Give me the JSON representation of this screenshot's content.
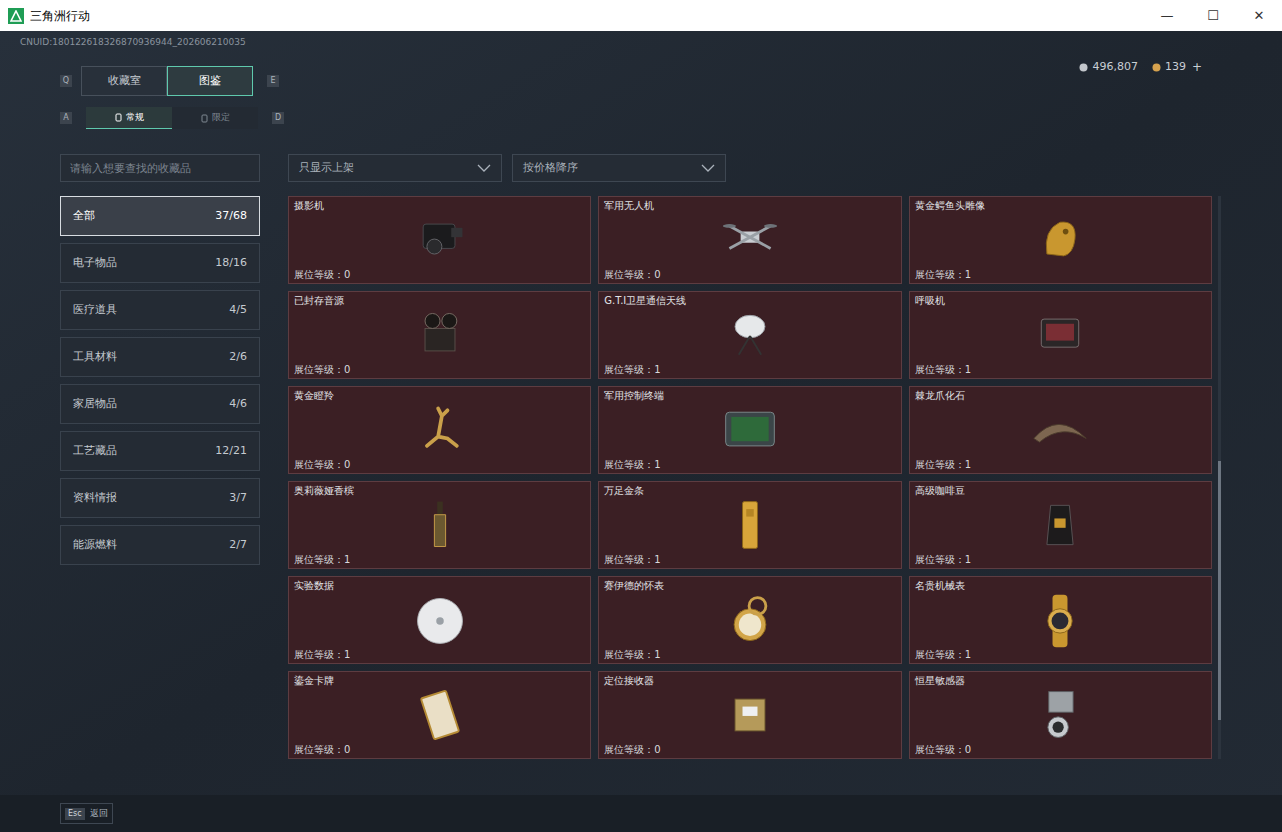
{
  "window": {
    "title": "三角洲行动",
    "controls": [
      "—",
      "☐",
      "✕"
    ]
  },
  "uid": "CNUID:180122618326870936944_202606210035",
  "currency": [
    {
      "amount": "496,807",
      "kind": "silver"
    },
    {
      "amount": "139",
      "kind": "gold"
    }
  ],
  "currency_add": "+",
  "tabs": {
    "left_key": "Q",
    "right_key": "E",
    "items": [
      {
        "label": "收藏室",
        "selected": false
      },
      {
        "label": "图鉴",
        "selected": true
      }
    ]
  },
  "subtabs": {
    "left_key": "A",
    "right_key": "D",
    "items": [
      {
        "label": "常规",
        "selected": true
      },
      {
        "label": "限定",
        "selected": false
      }
    ]
  },
  "search": {
    "placeholder": "请输入想要查找的收藏品"
  },
  "filters": [
    {
      "label": "只显示上架"
    },
    {
      "label": "按价格降序"
    }
  ],
  "categories": [
    {
      "label": "全部",
      "count": "37/68",
      "selected": true
    },
    {
      "label": "电子物品",
      "count": "18/16",
      "selected": false
    },
    {
      "label": "医疗道具",
      "count": "4/5",
      "selected": false
    },
    {
      "label": "工具材料",
      "count": "2/6",
      "selected": false
    },
    {
      "label": "家居物品",
      "count": "4/6",
      "selected": false
    },
    {
      "label": "工艺藏品",
      "count": "12/21",
      "selected": false
    },
    {
      "label": "资料情报",
      "count": "3/7",
      "selected": false
    },
    {
      "label": "能源燃料",
      "count": "2/7",
      "selected": false
    }
  ],
  "items": [
    {
      "name": "摄影机",
      "level": "展位等级：0"
    },
    {
      "name": "军用无人机",
      "level": "展位等级：0"
    },
    {
      "name": "黄金鳄鱼头雕像",
      "level": "展位等级：1"
    },
    {
      "name": "已封存音源",
      "level": "展位等级：0"
    },
    {
      "name": "G.T.I卫星通信天线",
      "level": "展位等级：1"
    },
    {
      "name": "呼吸机",
      "level": "展位等级：1"
    },
    {
      "name": "黄金瞪羚",
      "level": "展位等级：0"
    },
    {
      "name": "军用控制终端",
      "level": "展位等级：1"
    },
    {
      "name": "棘龙爪化石",
      "level": "展位等级：1"
    },
    {
      "name": "奥莉薇娅香槟",
      "level": "展位等级：1"
    },
    {
      "name": "万足金条",
      "level": "展位等级：1"
    },
    {
      "name": "高级咖啡豆",
      "level": "展位等级：1"
    },
    {
      "name": "实验数据",
      "level": "展位等级：1"
    },
    {
      "name": "赛伊德的怀表",
      "level": "展位等级：1"
    },
    {
      "name": "名贵机械表",
      "level": "展位等级：1"
    },
    {
      "name": "鎏金卡牌",
      "level": "展位等级：0"
    },
    {
      "name": "定位接收器",
      "level": "展位等级：0"
    },
    {
      "name": "恒星敏感器",
      "level": "展位等级：0"
    }
  ],
  "scrollbar": {
    "offset": 0.47,
    "size": 0.46
  },
  "footer": {
    "key": "Esc",
    "label": "返回"
  }
}
